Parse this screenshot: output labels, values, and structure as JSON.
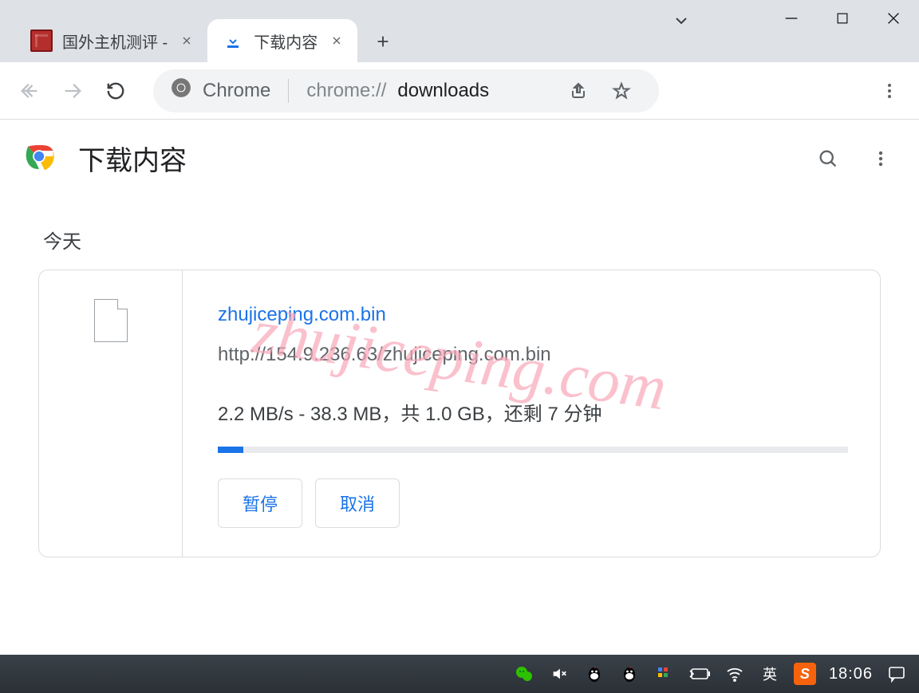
{
  "window": {
    "tabs": [
      {
        "title": "国外主机测评 -",
        "active": false
      },
      {
        "title": "下载内容",
        "active": true
      }
    ]
  },
  "toolbar": {
    "scheme_label": "Chrome",
    "url_prefix": "chrome://",
    "url_path": "downloads"
  },
  "page": {
    "title": "下载内容",
    "section_today": "今天",
    "watermark": "zhujiceping.com"
  },
  "download": {
    "filename": "zhujiceping.com.bin",
    "url": "http://154.9.236.63/zhujiceping.com.bin",
    "progress_text": "2.2 MB/s - 38.3 MB，共 1.0 GB，还剩 7 分钟",
    "progress_percent": 4,
    "pause_label": "暂停",
    "cancel_label": "取消"
  },
  "taskbar": {
    "ime": "英",
    "clock": "18:06"
  }
}
